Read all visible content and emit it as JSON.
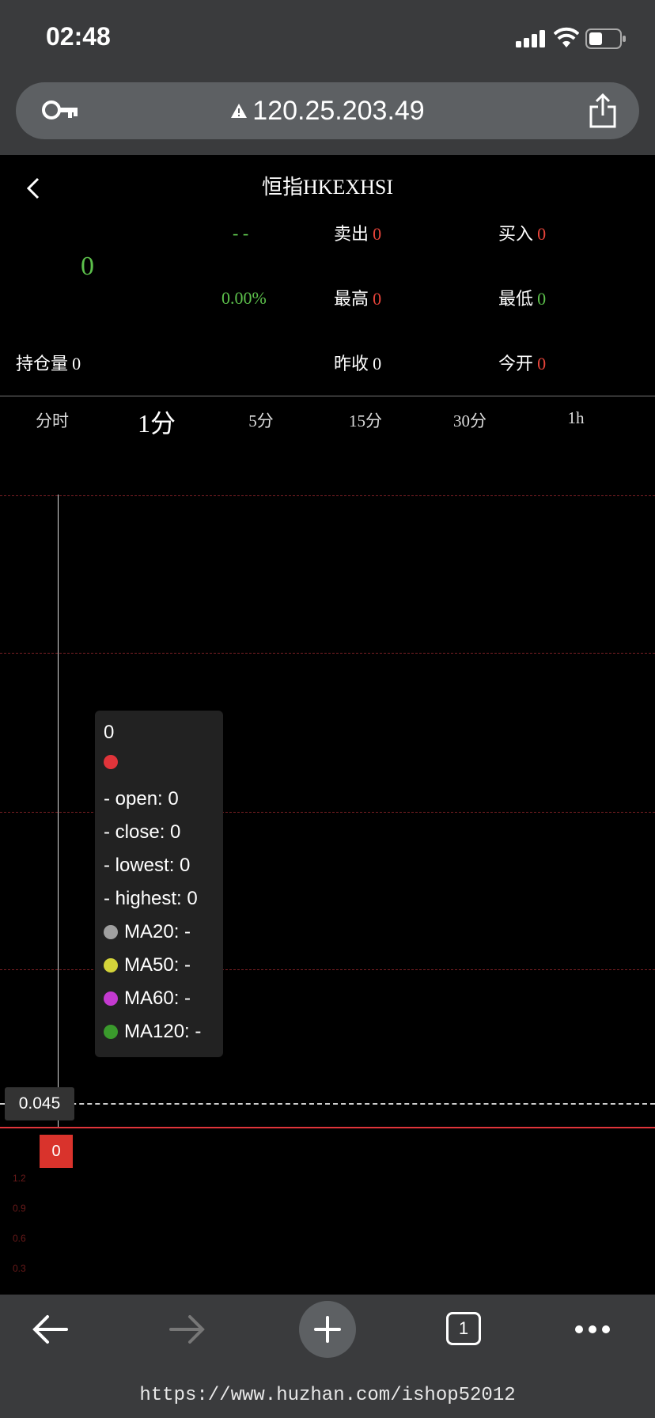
{
  "status_bar": {
    "time": "02:48"
  },
  "url_bar": {
    "url": "120.25.203.49"
  },
  "header": {
    "title": "恒指HKEXHSI"
  },
  "quote": {
    "price": "0",
    "change_abs": "- -",
    "change_pct": "0.00%",
    "sell_label": "卖出",
    "sell_value": "0",
    "buy_label": "买入",
    "buy_value": "0",
    "high_label": "最高",
    "high_value": "0",
    "low_label": "最低",
    "low_value": "0",
    "position_label": "持仓量",
    "position_value": "0",
    "prev_close_label": "昨收",
    "prev_close_value": "0",
    "open_label": "今开",
    "open_value": "0"
  },
  "periods": [
    "分时",
    "1分",
    "5分",
    "15分",
    "30分",
    "1h"
  ],
  "active_period": "1分",
  "chart": {
    "crosshair_value": "0.045",
    "current_price_tag": "0",
    "lower_axis_ticks": [
      "1.2",
      "0.9",
      "0.6",
      "0.3"
    ]
  },
  "tooltip": {
    "header": "0",
    "rows": [
      "- open: 0",
      "- close: 0",
      "- lowest: 0",
      "- highest: 0"
    ],
    "ma": [
      {
        "label": "MA20: -",
        "color": "#a0a0a0"
      },
      {
        "label": "MA50: -",
        "color": "#d4d43a"
      },
      {
        "label": "MA60: -",
        "color": "#c43ad0"
      },
      {
        "label": "MA120: -",
        "color": "#3a9a2c"
      }
    ],
    "candle_color": "#e0343a"
  },
  "toolbar": {
    "tab_count": "1"
  },
  "watermark": "https://www.huzhan.com/ishop52012",
  "colors": {
    "up": "#e8443a",
    "down": "#5cc04b",
    "chrome": "#3a3b3d"
  }
}
